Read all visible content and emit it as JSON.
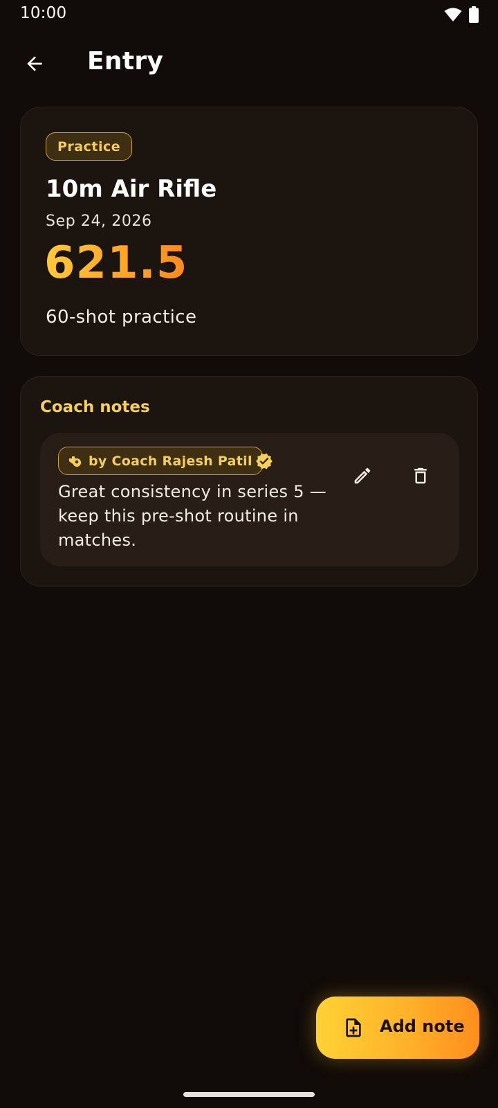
{
  "status_bar": {
    "time": "10:00"
  },
  "app_bar": {
    "title": "Entry"
  },
  "entry": {
    "badge": "Practice",
    "event": "10m Air Rifle",
    "date": "Sep 24, 2026",
    "score": "621.5",
    "description": "60-shot practice"
  },
  "notes": {
    "heading": "Coach notes",
    "items": [
      {
        "author": "by Coach Rajesh Patil",
        "text": "Great consistency in series 5 — keep this pre-shot routine in matches."
      }
    ]
  },
  "fab": {
    "label": "Add note"
  },
  "colors": {
    "background": "#110c09",
    "card": "#1c140f",
    "accent_gold": "#f5cf5a",
    "accent_orange": "#ff8e1d"
  }
}
